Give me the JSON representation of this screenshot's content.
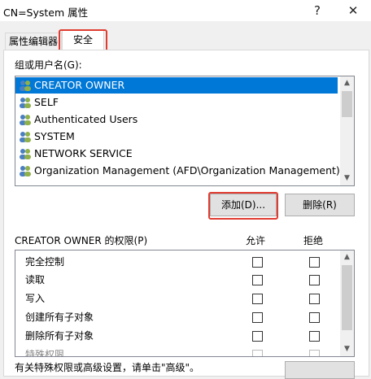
{
  "window": {
    "title": "CN=System 属性",
    "help": "?",
    "close": "✕"
  },
  "tabs": [
    {
      "label": "属性编辑器"
    },
    {
      "label": "安全"
    }
  ],
  "groups": {
    "label": "组或用户名(G):",
    "items": [
      {
        "name": "CREATOR OWNER",
        "selected": true
      },
      {
        "name": "SELF"
      },
      {
        "name": "Authenticated Users"
      },
      {
        "name": "SYSTEM"
      },
      {
        "name": "NETWORK SERVICE"
      },
      {
        "name": "Organization Management (AFD\\Organization Management)"
      }
    ]
  },
  "buttons": {
    "add": "添加(D)...",
    "remove": "删除(R)"
  },
  "permissions": {
    "label": "CREATOR OWNER 的权限(P)",
    "allow_header": "允许",
    "deny_header": "拒绝",
    "items": [
      {
        "name": "完全控制"
      },
      {
        "name": "读取"
      },
      {
        "name": "写入"
      },
      {
        "name": "创建所有子对象"
      },
      {
        "name": "删除所有子对象"
      },
      {
        "name": "特殊权限"
      }
    ]
  },
  "footer": {
    "text": "有关特殊权限或高级设置，请单击\"高级\"。"
  },
  "colors": {
    "selection": "#0078d7",
    "highlight": "#e03c31"
  }
}
